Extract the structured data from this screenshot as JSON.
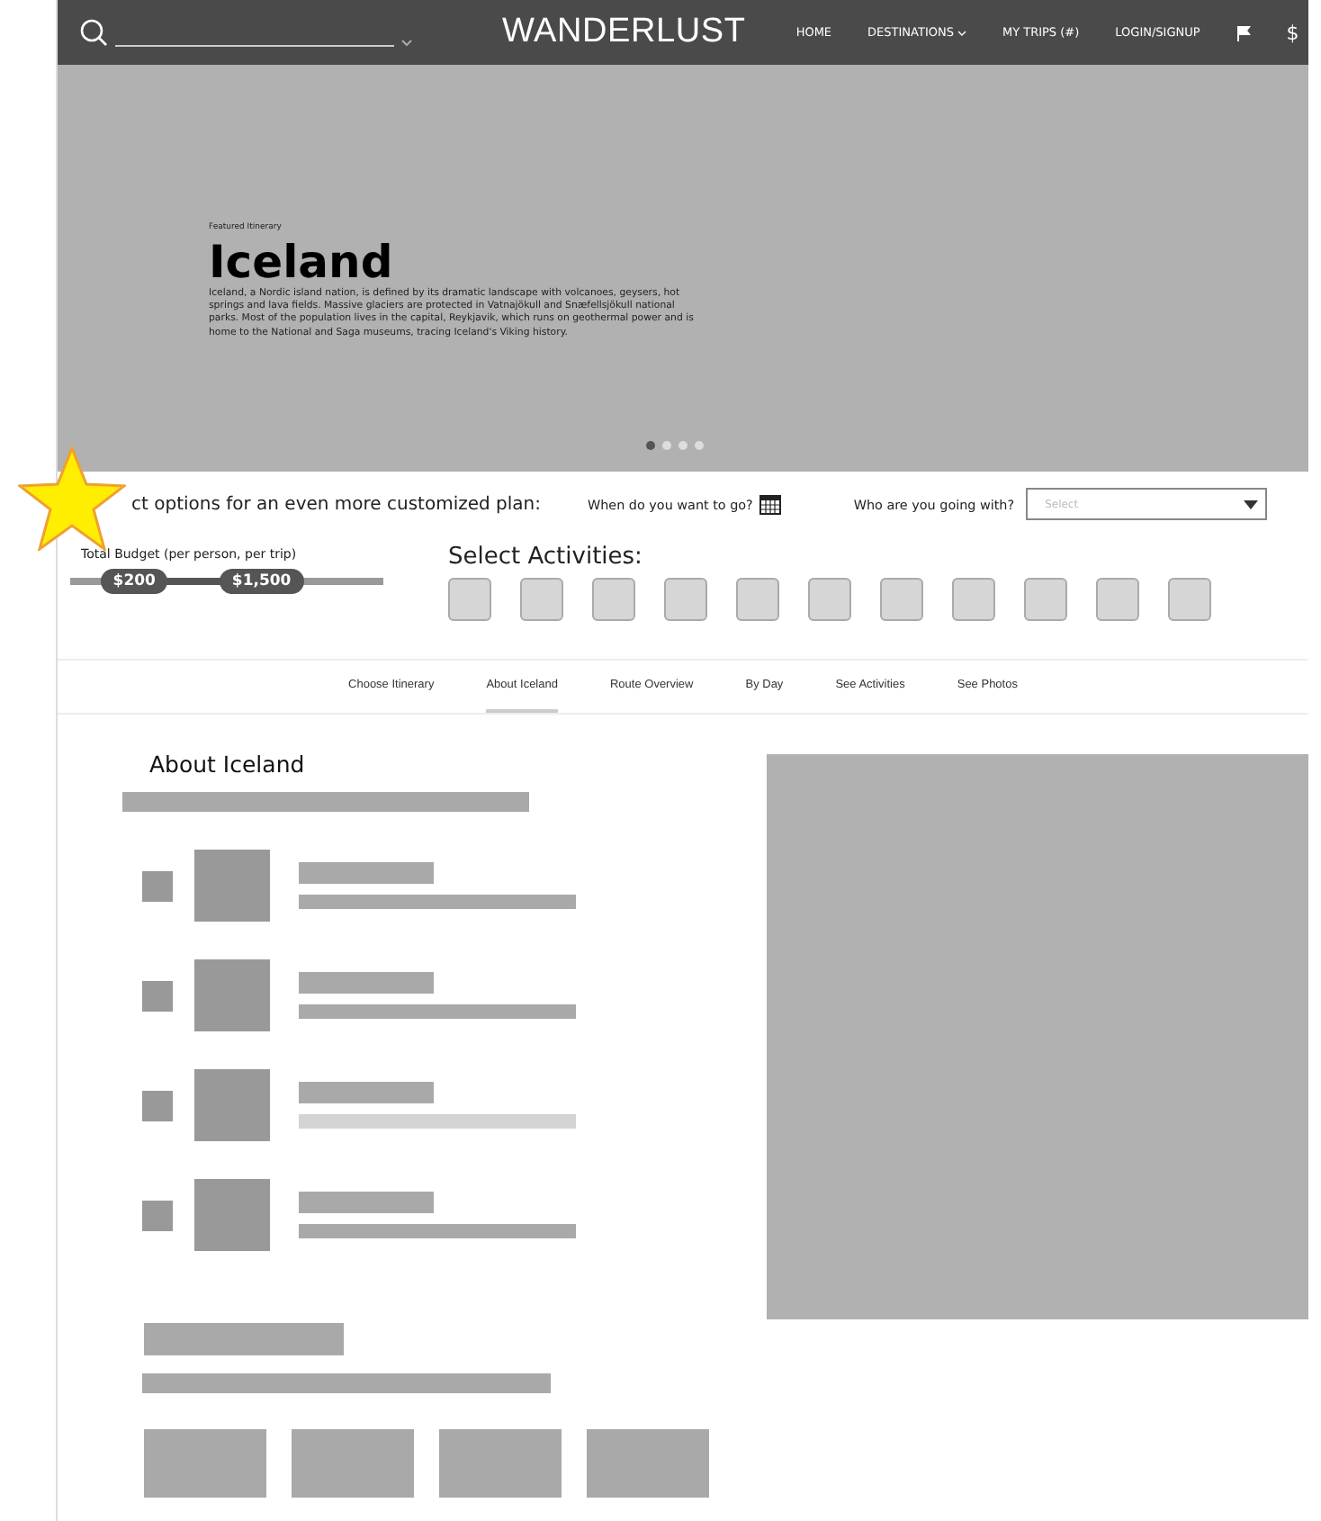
{
  "nav": {
    "logo": "WANDERLUST",
    "links": [
      {
        "label": "HOME",
        "has_menu": false
      },
      {
        "label": "DESTINATIONS",
        "has_menu": true
      },
      {
        "label": "MY TRIPS (#)",
        "has_menu": false
      },
      {
        "label": "LOGIN/SIGNUP",
        "has_menu": false
      }
    ],
    "currency": "$"
  },
  "hero": {
    "eyebrow": "Featured Itinerary",
    "title": "Iceland",
    "description": "Iceland, a Nordic island nation, is defined by its dramatic landscape with volcanoes, geysers, hot springs and lava fields. Massive glaciers are protected in Vatnajökull and Snæfellsjökull national parks. Most of the population lives in the capital, Reykjavik, which runs on geothermal power and is home to the National and Saga museums, tracing Iceland's Viking history.",
    "dots": [
      {
        "selected": true
      },
      {
        "selected": false
      },
      {
        "selected": false
      },
      {
        "selected": false
      }
    ]
  },
  "options": {
    "intro": "ct options for an even more customized plan:",
    "when_label": "When do you want to go?",
    "who_label": "Who are you going with?",
    "who_select": {
      "placeholder": "Select"
    }
  },
  "budget": {
    "label": "Total Budget (per person, per trip)",
    "handles": [
      {
        "label": "$200",
        "level": 0.2
      },
      {
        "label": "$1,500",
        "level": 0.58
      }
    ]
  },
  "activities": {
    "title": "Select Activities:",
    "options": [
      {
        "selected": false
      },
      {
        "selected": false
      },
      {
        "selected": false
      },
      {
        "selected": false
      },
      {
        "selected": false
      },
      {
        "selected": false
      },
      {
        "selected": false
      },
      {
        "selected": false
      },
      {
        "selected": false
      },
      {
        "selected": false
      },
      {
        "selected": false
      }
    ]
  },
  "tabs": [
    {
      "label": "Choose Itinerary",
      "selected": false
    },
    {
      "label": "About Iceland",
      "selected": true
    },
    {
      "label": "Route Overview",
      "selected": false
    },
    {
      "label": "By Day",
      "selected": false
    },
    {
      "label": "See Activities",
      "selected": false
    },
    {
      "label": "See Photos",
      "selected": false
    }
  ],
  "section": {
    "title": "About Iceland",
    "list_items": [
      {
        "checked": false,
        "dimmed": false
      },
      {
        "checked": false,
        "dimmed": false
      },
      {
        "checked": false,
        "dimmed": true
      },
      {
        "checked": false,
        "dimmed": false
      }
    ]
  }
}
